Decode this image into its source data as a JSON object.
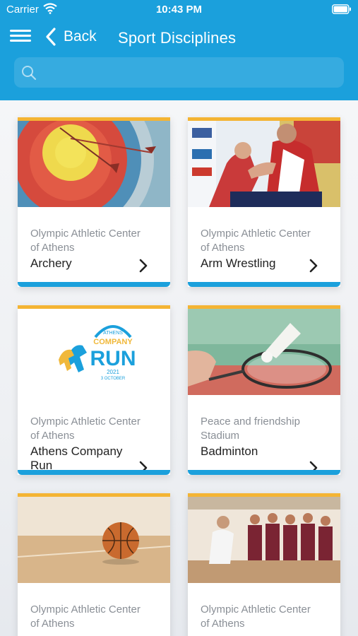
{
  "status_bar": {
    "carrier": "Carrier",
    "time": "10:43 PM"
  },
  "nav": {
    "back_label": "Back",
    "title": "Sport Disciplines"
  },
  "search": {
    "placeholder": "",
    "value": ""
  },
  "cards": [
    {
      "venue": "Olympic Athletic Center of Athens",
      "name": "Archery",
      "image": "archery-target"
    },
    {
      "venue": "Olympic Athletic Center of Athens",
      "name": "Arm Wrestling",
      "image": "arm-wrestling-photo"
    },
    {
      "venue": "Olympic Athletic Center of Athens",
      "name": "Athens Company Run",
      "image": "athens-company-run-logo",
      "logo_text": {
        "top": "ATHENS",
        "mid": "COMPANY",
        "main": "RUN",
        "year": "2021",
        "date": "3 OCTOBER"
      }
    },
    {
      "venue": "Peace and friendship Stadium",
      "name": "Badminton",
      "image": "badminton-shuttlecock"
    },
    {
      "venue": "Olympic Athletic Center of Athens",
      "name": "",
      "image": "basketball-ball"
    },
    {
      "venue": "Olympic Athletic Center of Athens",
      "name": "",
      "image": "basketball-team-huddle"
    }
  ],
  "colors": {
    "header": "#1ba0dc",
    "card_top_border": "#f4b433",
    "card_bottom_border": "#1ba0dc"
  }
}
